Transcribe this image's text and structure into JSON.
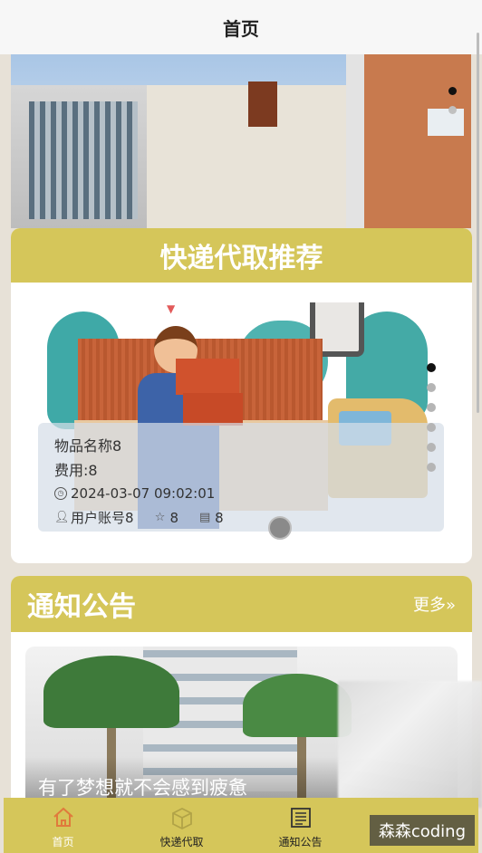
{
  "header": {
    "title": "首页"
  },
  "express_section": {
    "title": "快递代取推荐",
    "item": {
      "name": "物品名称8",
      "fee": "费用:8",
      "datetime": "2024-03-07 09:02:01",
      "user": "用户账号8",
      "stars": "8",
      "views": "8"
    },
    "carousel_index": 1,
    "carousel_count": 6
  },
  "notice_section": {
    "title": "通知公告",
    "more": "更多»",
    "caption": "有了梦想就不会感到疲惫"
  },
  "tabbar": {
    "items": [
      {
        "label": "首页",
        "icon": "home-icon",
        "active": true
      },
      {
        "label": "快递代取",
        "icon": "package-icon",
        "active": false
      },
      {
        "label": "通知公告",
        "icon": "newspaper-icon",
        "active": false
      }
    ]
  },
  "watermark": "森森coding",
  "colors": {
    "accent": "#d5c65a",
    "accent_dark": "#e07a3c"
  }
}
